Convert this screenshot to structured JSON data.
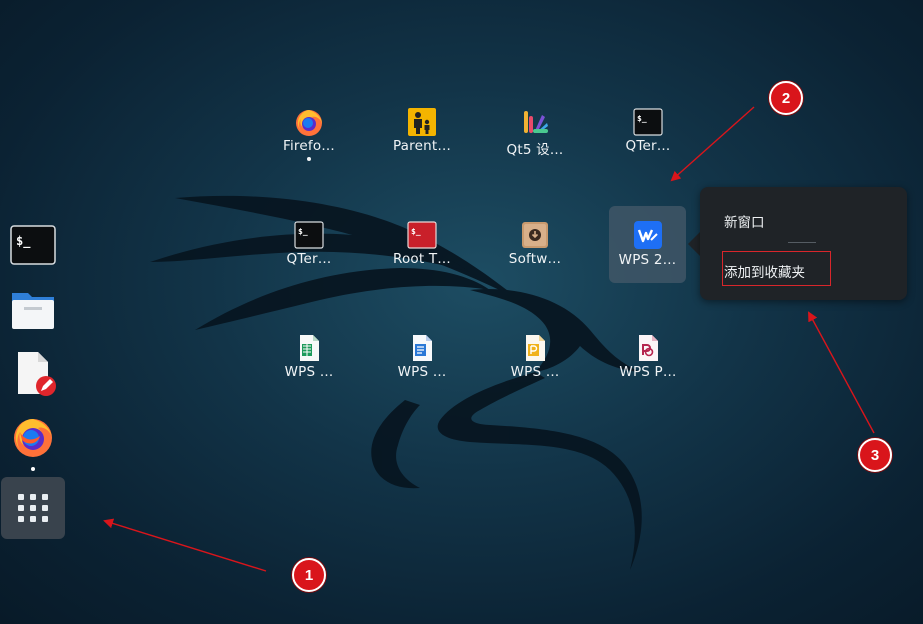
{
  "dock": {
    "items": [
      {
        "name": "terminal",
        "icon": "terminal-icon"
      },
      {
        "name": "files",
        "icon": "folder-icon"
      },
      {
        "name": "text-editor",
        "icon": "document-edit-icon"
      },
      {
        "name": "firefox",
        "icon": "firefox-icon",
        "running": true
      }
    ],
    "show_apps_icon": "grid-icon"
  },
  "apps": [
    {
      "label": "Firefo…",
      "icon": "firefox-icon",
      "running": true
    },
    {
      "label": "Parent…",
      "icon": "parental-controls-icon"
    },
    {
      "label": "Qt5 设…",
      "icon": "qt5-settings-icon"
    },
    {
      "label": "QTer…",
      "icon": "terminal-icon"
    },
    {
      "label": "QTer…",
      "icon": "terminal-icon"
    },
    {
      "label": "Root T…",
      "icon": "root-terminal-icon"
    },
    {
      "label": "Softw…",
      "icon": "software-icon"
    },
    {
      "label": "WPS 2…",
      "icon": "wps-office-icon",
      "selected": true
    },
    {
      "label": "WPS …",
      "icon": "wps-spreadsheets-icon"
    },
    {
      "label": "WPS …",
      "icon": "wps-writer-icon"
    },
    {
      "label": "WPS …",
      "icon": "wps-presentation-icon"
    },
    {
      "label": "WPS P…",
      "icon": "wps-pdf-icon"
    }
  ],
  "context_menu": {
    "new_window": "新窗口",
    "add_to_favorites": "添加到收藏夹"
  },
  "annotations": {
    "badge_1": "1",
    "badge_2": "2",
    "badge_3": "3",
    "color": "#d9151b"
  }
}
